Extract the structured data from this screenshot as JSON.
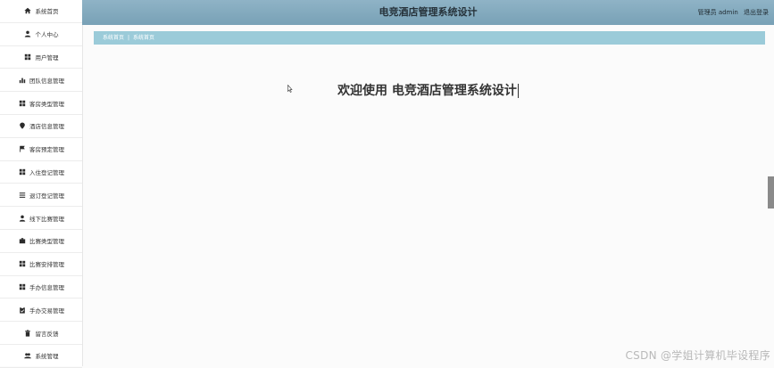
{
  "app": {
    "title": "电竞酒店管理系统设计",
    "user_label": "管理员 admin",
    "logout_label": "退出登录"
  },
  "sidebar": {
    "items": [
      {
        "label": "系统首页",
        "icon": "home-icon"
      },
      {
        "label": "个人中心",
        "icon": "user-icon"
      },
      {
        "label": "用户管理",
        "icon": "grid-icon"
      },
      {
        "label": "团队信息管理",
        "icon": "bar-chart-icon"
      },
      {
        "label": "客房类型管理",
        "icon": "grid-icon"
      },
      {
        "label": "酒店信息管理",
        "icon": "map-pin-icon"
      },
      {
        "label": "客房预定管理",
        "icon": "flag-icon"
      },
      {
        "label": "入住登记管理",
        "icon": "grid-icon"
      },
      {
        "label": "退订登记管理",
        "icon": "list-icon"
      },
      {
        "label": "线下比赛管理",
        "icon": "user-icon"
      },
      {
        "label": "比赛类型管理",
        "icon": "briefcase-icon"
      },
      {
        "label": "比赛安排管理",
        "icon": "grid-icon"
      },
      {
        "label": "手办信息管理",
        "icon": "grid-icon"
      },
      {
        "label": "手办交易管理",
        "icon": "clipboard-icon"
      },
      {
        "label": "留言反馈",
        "icon": "trash-icon"
      },
      {
        "label": "系统管理",
        "icon": "users-icon"
      }
    ]
  },
  "breadcrumb": {
    "items": [
      "系统首页",
      "系统首页"
    ],
    "separator": "|"
  },
  "main": {
    "welcome_text": "欢迎使用 电竞酒店管理系统设计"
  },
  "watermark": "CSDN @学姐计算机毕设程序",
  "colors": {
    "header": "#7fa7bb",
    "breadcrumb": "#9bcbd9",
    "background": "#fbfbfb"
  }
}
